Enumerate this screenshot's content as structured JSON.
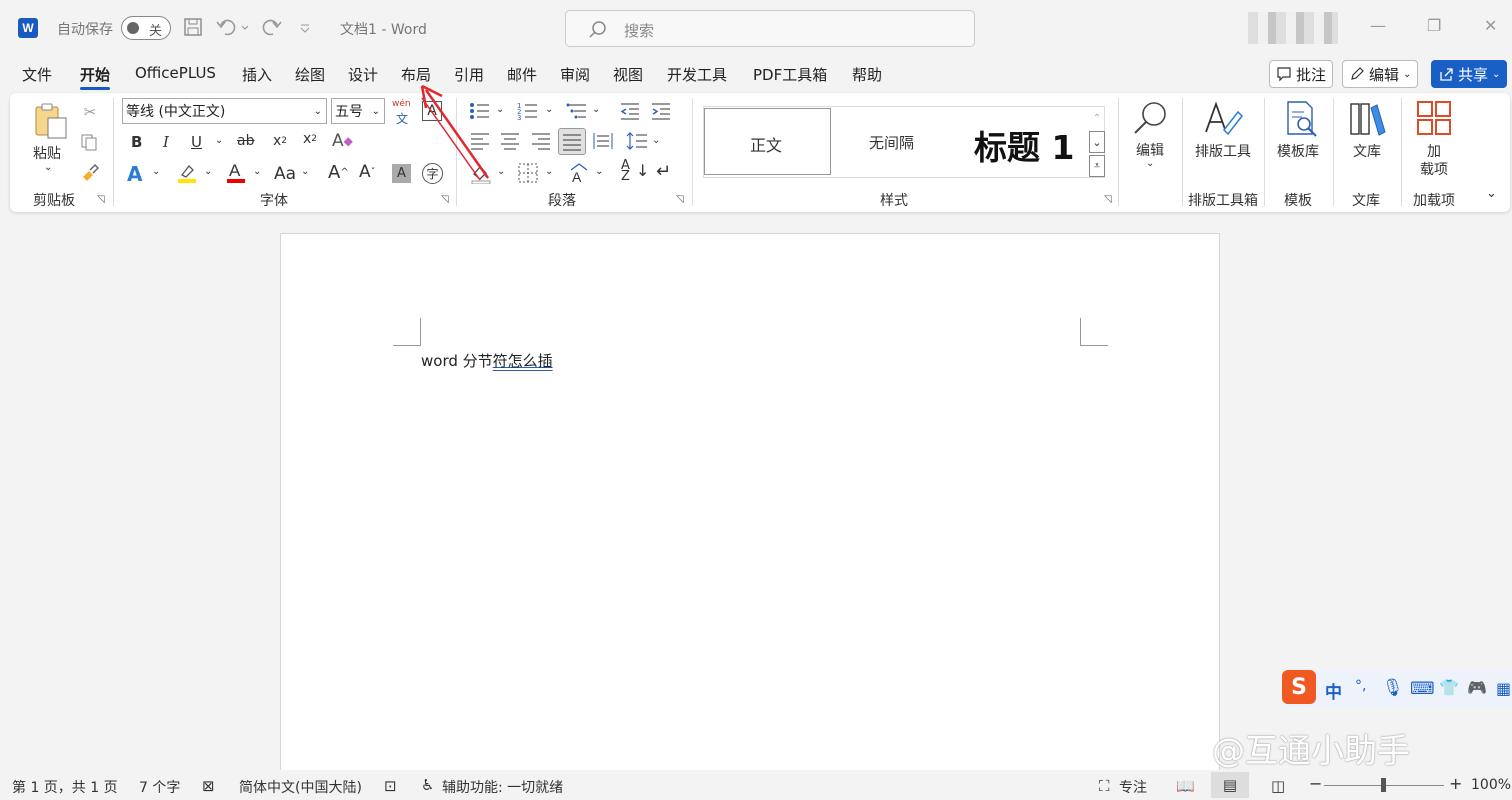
{
  "titlebar": {
    "app_icon": "W",
    "autosave_label": "自动保存",
    "autosave_state": "关",
    "doc_title": "文档1  -  Word",
    "search_placeholder": "搜索",
    "minimize": "—",
    "restore": "❐",
    "close": "✕"
  },
  "menu": {
    "tabs": [
      "文件",
      "开始",
      "OfficePLUS",
      "插入",
      "绘图",
      "设计",
      "布局",
      "引用",
      "邮件",
      "审阅",
      "视图",
      "开发工具",
      "PDF工具箱",
      "帮助"
    ],
    "active": "开始",
    "comments": "批注",
    "editing": "编辑",
    "share": "共享"
  },
  "ribbon": {
    "clipboard": {
      "paste": "粘贴",
      "label": "剪贴板"
    },
    "font": {
      "name": "等线 (中文正文)",
      "size": "五号",
      "phonetic": "wén",
      "label": "字体"
    },
    "paragraph": {
      "label": "段落"
    },
    "styles": {
      "items": [
        "正文",
        "无间隔",
        "标题 1"
      ],
      "label": "样式"
    },
    "edit": {
      "label": "编辑"
    },
    "layout_tools": {
      "button": "排版工具",
      "label": "排版工具箱"
    },
    "templates": {
      "button": "模板库",
      "label": "模板"
    },
    "library": {
      "button": "文库",
      "label": "文库"
    },
    "addins": {
      "button_line1": "加",
      "button_line2": "载项",
      "label": "加载项"
    }
  },
  "document": {
    "text_plain": "word 分节",
    "text_underlined": "符怎么插"
  },
  "statusbar": {
    "pages": "第 1 页，共 1 页",
    "words": "7 个字",
    "language": "简体中文(中国大陆)",
    "accessibility": "辅助功能: 一切就绪",
    "focus": "专注",
    "zoom": "100%"
  },
  "ime": {
    "mode": "中",
    "punct": "°,"
  },
  "watermark": "@互通小助手",
  "colors": {
    "accent": "#185abd",
    "share": "#1a5fc6",
    "arrow": "#e0282e"
  }
}
